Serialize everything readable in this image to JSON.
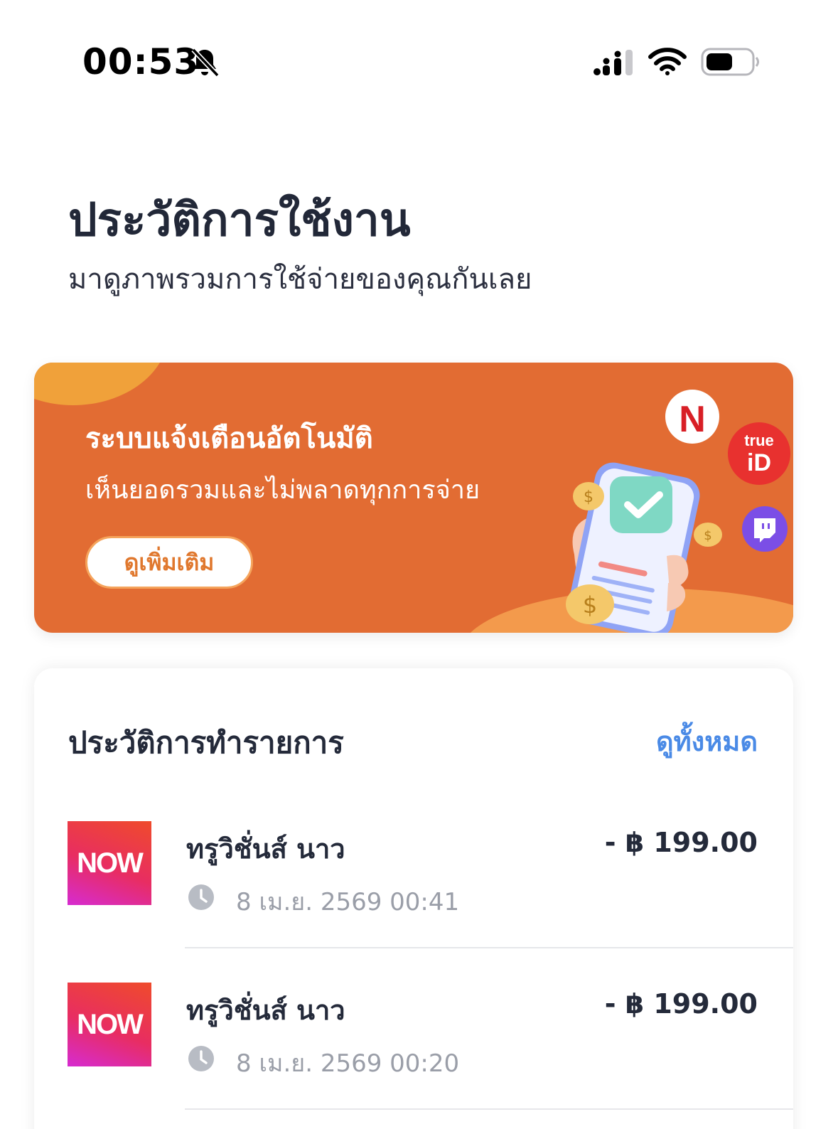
{
  "status_bar": {
    "time": "00:53",
    "icons": [
      "bell-slash-icon",
      "cellular-signal-icon",
      "wifi-icon",
      "battery-icon"
    ]
  },
  "header": {
    "title": "ประวัติการใช้งาน",
    "subtitle": "มาดูภาพรวมการใช้จ่ายของคุณกันเลย"
  },
  "banner": {
    "title": "ระบบแจ้งเตือนอัตโนมัติ",
    "subtitle": "เห็นยอดรวมและไม่พลาดทุกการจ่าย",
    "button_label": "ดูเพิ่มเติม",
    "service_logos": [
      "netflix-logo",
      "trueid-logo",
      "twitch-logo"
    ],
    "netflix_letter": "N",
    "trueid_text": "true",
    "trueid_id": "iD",
    "colors": {
      "background": "#e26c33",
      "accent": "#f0a13a"
    }
  },
  "transactions": {
    "title": "ประวัติการทำรายการ",
    "view_all_label": "ดูทั้งหมด",
    "items": [
      {
        "logo_text": "NOW",
        "name": "ทรูวิชั่นส์ นาว",
        "amount": "- ฿ 199.00",
        "datetime": "8 เม.ย. 2569 00:41"
      },
      {
        "logo_text": "NOW",
        "name": "ทรูวิชั่นส์ นาว",
        "amount": "- ฿ 199.00",
        "datetime": "8 เม.ย. 2569 00:20"
      }
    ]
  }
}
